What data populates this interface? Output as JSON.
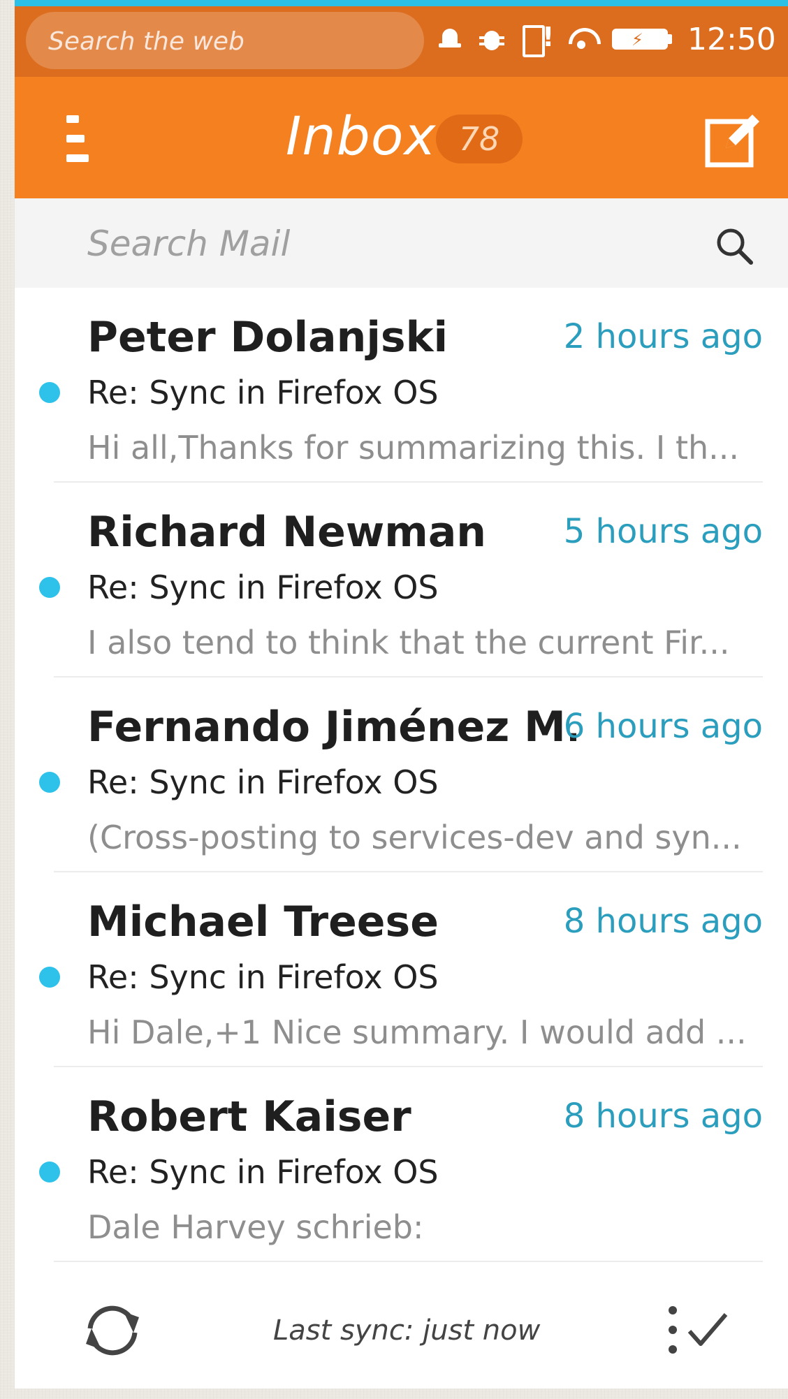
{
  "status_bar": {
    "search_placeholder": "Search the web",
    "time": "12:50",
    "icons": [
      "bell-icon",
      "bug-icon",
      "sim-alert-icon",
      "wifi-icon",
      "battery-charging-icon"
    ]
  },
  "header": {
    "title": "Inbox",
    "unread_count": "78",
    "menu_icon": "hamburger-menu-icon",
    "compose_icon": "compose-icon"
  },
  "search": {
    "placeholder": "Search Mail",
    "icon": "search-icon"
  },
  "messages": [
    {
      "sender": "Peter Dolanjski",
      "time": "2 hours ago",
      "subject": "Re: Sync in Firefox OS",
      "preview": "Hi all,Thanks for summarizing this. I th...",
      "unread": true
    },
    {
      "sender": "Richard Newman",
      "time": "5 hours ago",
      "subject": "Re: Sync in Firefox OS",
      "preview": "I also tend to think that the current Fir...",
      "unread": true
    },
    {
      "sender": "Fernando Jiménez M...",
      "time": "6 hours ago",
      "subject": "Re: Sync in Firefox OS",
      "preview": "(Cross-posting to services-dev and syn...",
      "unread": true
    },
    {
      "sender": "Michael Treese",
      "time": "8 hours ago",
      "subject": "Re: Sync in Firefox OS",
      "preview": "Hi Dale,+1 Nice summary. I would add ...",
      "unread": true
    },
    {
      "sender": "Robert Kaiser",
      "time": "8 hours ago",
      "subject": "Re: Sync in Firefox OS",
      "preview": "Dale Harvey schrieb:",
      "unread": true
    }
  ],
  "footer": {
    "last_sync": "Last sync: just now",
    "sync_icon": "sync-icon",
    "edit_icon": "edit-mode-icon"
  },
  "colors": {
    "status_bar": "#dd6d1e",
    "header": "#f4801f",
    "accent_blue": "#2c9ebd",
    "unread_dot": "#2ec2ea"
  }
}
